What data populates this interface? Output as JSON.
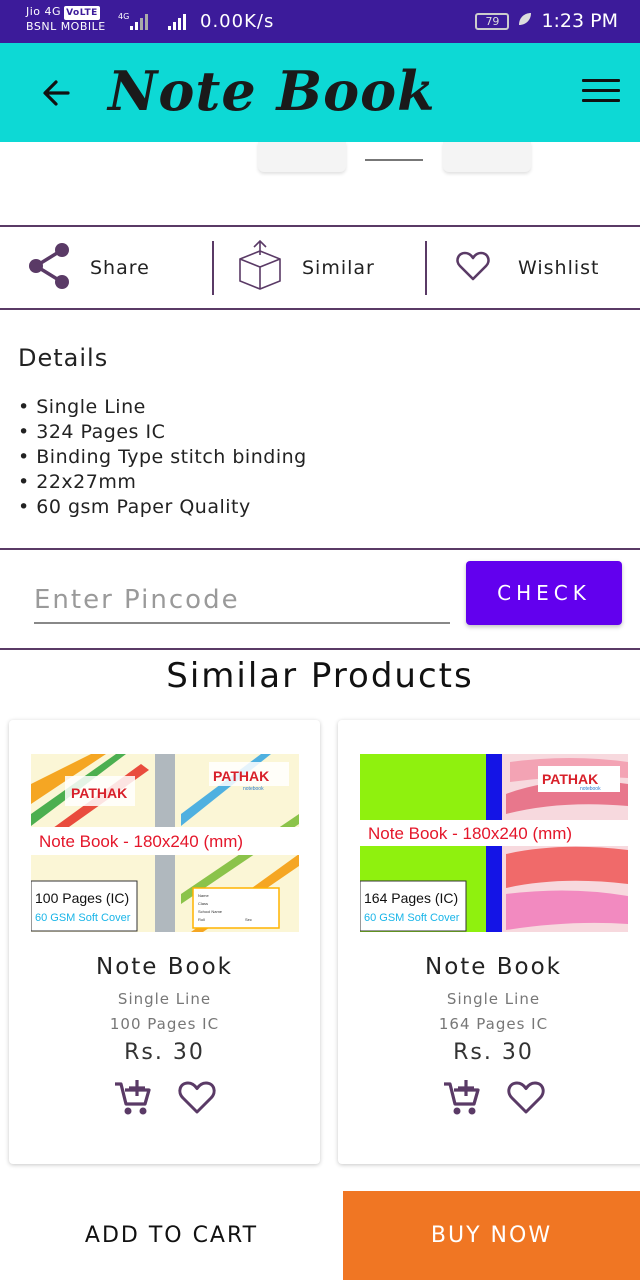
{
  "status_bar": {
    "carrier_line1": "Jio 4G",
    "volte": "VoLTE",
    "carrier_line2": "BSNL MOBILE",
    "net_type": "4G",
    "speed": "0.00K/s",
    "battery": "79",
    "time": "1:23 PM"
  },
  "app_bar": {
    "title": "Note Book",
    "back_icon": "arrow-left-icon",
    "menu_icon": "hamburger-menu-icon"
  },
  "actions": {
    "share": "Share",
    "similar": "Similar",
    "wishlist": "Wishlist"
  },
  "details": {
    "title": "Details",
    "items": [
      "Single Line",
      "324 Pages IC",
      "Binding Type stitch binding",
      "22x27mm",
      "60 gsm Paper Quality"
    ]
  },
  "pincode": {
    "placeholder": "Enter Pincode",
    "button": "CHECK"
  },
  "similar": {
    "title": "Similar Products",
    "products": [
      {
        "name": "Note Book",
        "line": "Single Line",
        "pages": "100 Pages IC",
        "price": "Rs. 30",
        "img_brand": "PATHAK",
        "img_brand_sub": "notebook",
        "img_banner": "Note Book - 180x240 (mm)",
        "img_pages": "100 Pages (IC)",
        "img_cover": "60 GSM Soft Cover",
        "img_form_name": "Name",
        "img_form_class": "Class",
        "img_form_school": "School Name",
        "img_form_roll": "Roll",
        "img_form_sec": "Sec"
      },
      {
        "name": "Note Book",
        "line": "Single Line",
        "pages": "164 Pages IC",
        "price": "Rs. 30",
        "img_brand": "PATHAK",
        "img_brand_sub": "notebook",
        "img_banner": "Note Book - 180x240 (mm)",
        "img_pages": "164 Pages (IC)",
        "img_cover": "60 GSM Soft Cover"
      }
    ]
  },
  "bottom": {
    "add_to_cart": "ADD TO CART",
    "buy_now": "BUY NOW"
  },
  "colors": {
    "status_bar": "#3c1b9a",
    "app_bar": "#0dd9d5",
    "accent": "#6200ee",
    "buy_now": "#f07623",
    "icon": "#5a3a66"
  }
}
